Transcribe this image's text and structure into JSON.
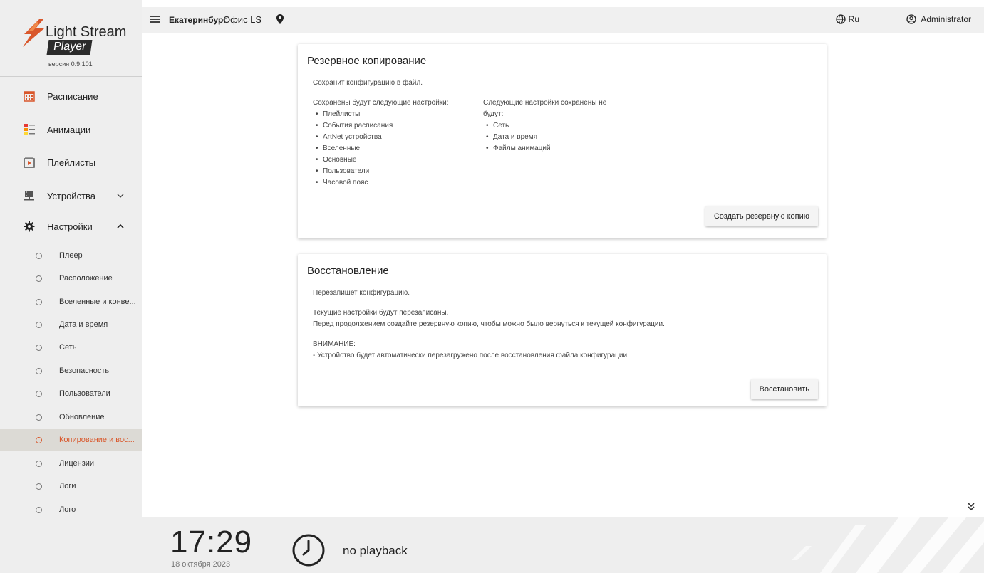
{
  "app": {
    "logo_title": "Light Stream",
    "logo_subtitle": "Player",
    "version": "версия 0.9.101"
  },
  "sidebar": {
    "items": [
      {
        "label": "Расписание",
        "icon": "calendar-icon"
      },
      {
        "label": "Анимации",
        "icon": "animations-icon"
      },
      {
        "label": "Плейлисты",
        "icon": "playlist-icon"
      },
      {
        "label": "Устройства",
        "icon": "devices-icon",
        "expanded": false
      },
      {
        "label": "Настройки",
        "icon": "gear-icon",
        "expanded": true
      }
    ],
    "settings_sub": [
      {
        "label": "Плеер"
      },
      {
        "label": "Расположение"
      },
      {
        "label": "Вселенные и конве..."
      },
      {
        "label": "Дата и время"
      },
      {
        "label": "Сеть"
      },
      {
        "label": "Безопасность"
      },
      {
        "label": "Пользователи"
      },
      {
        "label": "Обновление"
      },
      {
        "label": "Копирование и вос...",
        "active": true
      },
      {
        "label": "Лицензии"
      },
      {
        "label": "Логи"
      },
      {
        "label": "Лого"
      }
    ]
  },
  "topbar": {
    "city": "Екатеринбург",
    "office": "Офис LS",
    "language": "Ru",
    "user": "Administrator"
  },
  "backup": {
    "title": "Резервное копирование",
    "description": "Сохранит конфигурацию в файл.",
    "saved_heading": "Сохранены будут следующие настройки:",
    "saved_items": [
      "Плейлисты",
      "События расписания",
      "ArtNet устройства",
      "Вселенные",
      "Основные",
      "Пользователи",
      "Часовой пояс"
    ],
    "not_saved_heading": "Следующие настройки сохранены не будут:",
    "not_saved_items": [
      "Сеть",
      "Дата и время",
      "Файлы анимаций"
    ],
    "button": "Создать резервную копию"
  },
  "restore": {
    "title": "Восстановление",
    "description": "Перезапишет конфигурацию.",
    "line1": "Текущие настройки будут перезаписаны.",
    "line2": "Перед продолжением создайте резервную копию, чтобы можно было вернуться к текущей конфигурации.",
    "warning_heading": "ВНИМАНИЕ:",
    "warning_text": "- Устройство будет автоматически перезагружено после восстановления файла конфигурации.",
    "button": "Восстановить"
  },
  "status": {
    "time": "17:29",
    "date": "18 октября 2023",
    "playback": "no playback"
  },
  "colors": {
    "accent": "#d9572b",
    "sidebar_bg": "#eeeeee",
    "active_bg": "#dcdad5"
  }
}
